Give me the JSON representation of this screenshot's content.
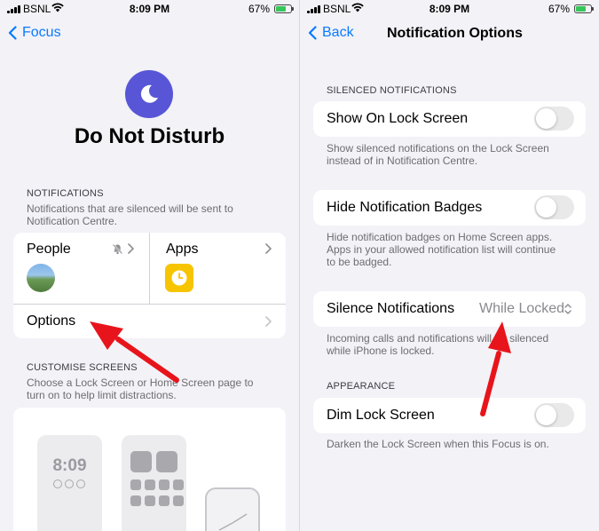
{
  "colors": {
    "accent": "#0a7aff",
    "moon_bg": "#5856d6",
    "arrow": "#e8141b",
    "toggle_off": "#e9e9ea",
    "battery": "#35c759"
  },
  "left_screen": {
    "status_bar": {
      "carrier": "BSNL",
      "time": "8:09 PM",
      "battery": "67%"
    },
    "nav": {
      "back_label": "Focus"
    },
    "header": {
      "icon": "moon-icon",
      "title": "Do Not Disturb"
    },
    "notifications": {
      "heading": "NOTIFICATIONS",
      "description_line1": "Notifications that are silenced will be sent to",
      "description_line2": "Notification Centre.",
      "people_label": "People",
      "people_icon": "bell-slash-icon",
      "apps_label": "Apps",
      "apps_icon": "clock-app-icon",
      "options_label": "Options"
    },
    "customise": {
      "heading": "CUSTOMISE SCREENS",
      "description_line1": "Choose a Lock Screen or Home Screen page to",
      "description_line2": "turn on to help limit distractions.",
      "lock_preview_time": "8:09"
    }
  },
  "right_screen": {
    "status_bar": {
      "carrier": "BSNL",
      "time": "8:09 PM",
      "battery": "67%"
    },
    "nav": {
      "back_label": "Back",
      "title": "Notification Options"
    },
    "silenced": {
      "heading": "SILENCED NOTIFICATIONS",
      "show_on_lock_label": "Show On Lock Screen",
      "show_on_lock_on": false,
      "show_on_lock_desc_line1": "Show silenced notifications on the Lock Screen",
      "show_on_lock_desc_line2": "instead of in Notification Centre.",
      "hide_badges_label": "Hide Notification Badges",
      "hide_badges_on": false,
      "hide_badges_desc_line1": "Hide notification badges on Home Screen apps.",
      "hide_badges_desc_line2": "Apps in your allowed notification list will continue",
      "hide_badges_desc_line3": "to be badged.",
      "silence_label": "Silence Notifications",
      "silence_value": "While Locked",
      "silence_desc_line1": "Incoming calls and notifications will be silenced",
      "silence_desc_line2": "while iPhone is locked."
    },
    "appearance": {
      "heading": "APPEARANCE",
      "dim_label": "Dim Lock Screen",
      "dim_on": false,
      "dim_desc": "Darken the Lock Screen when this Focus is on."
    }
  }
}
